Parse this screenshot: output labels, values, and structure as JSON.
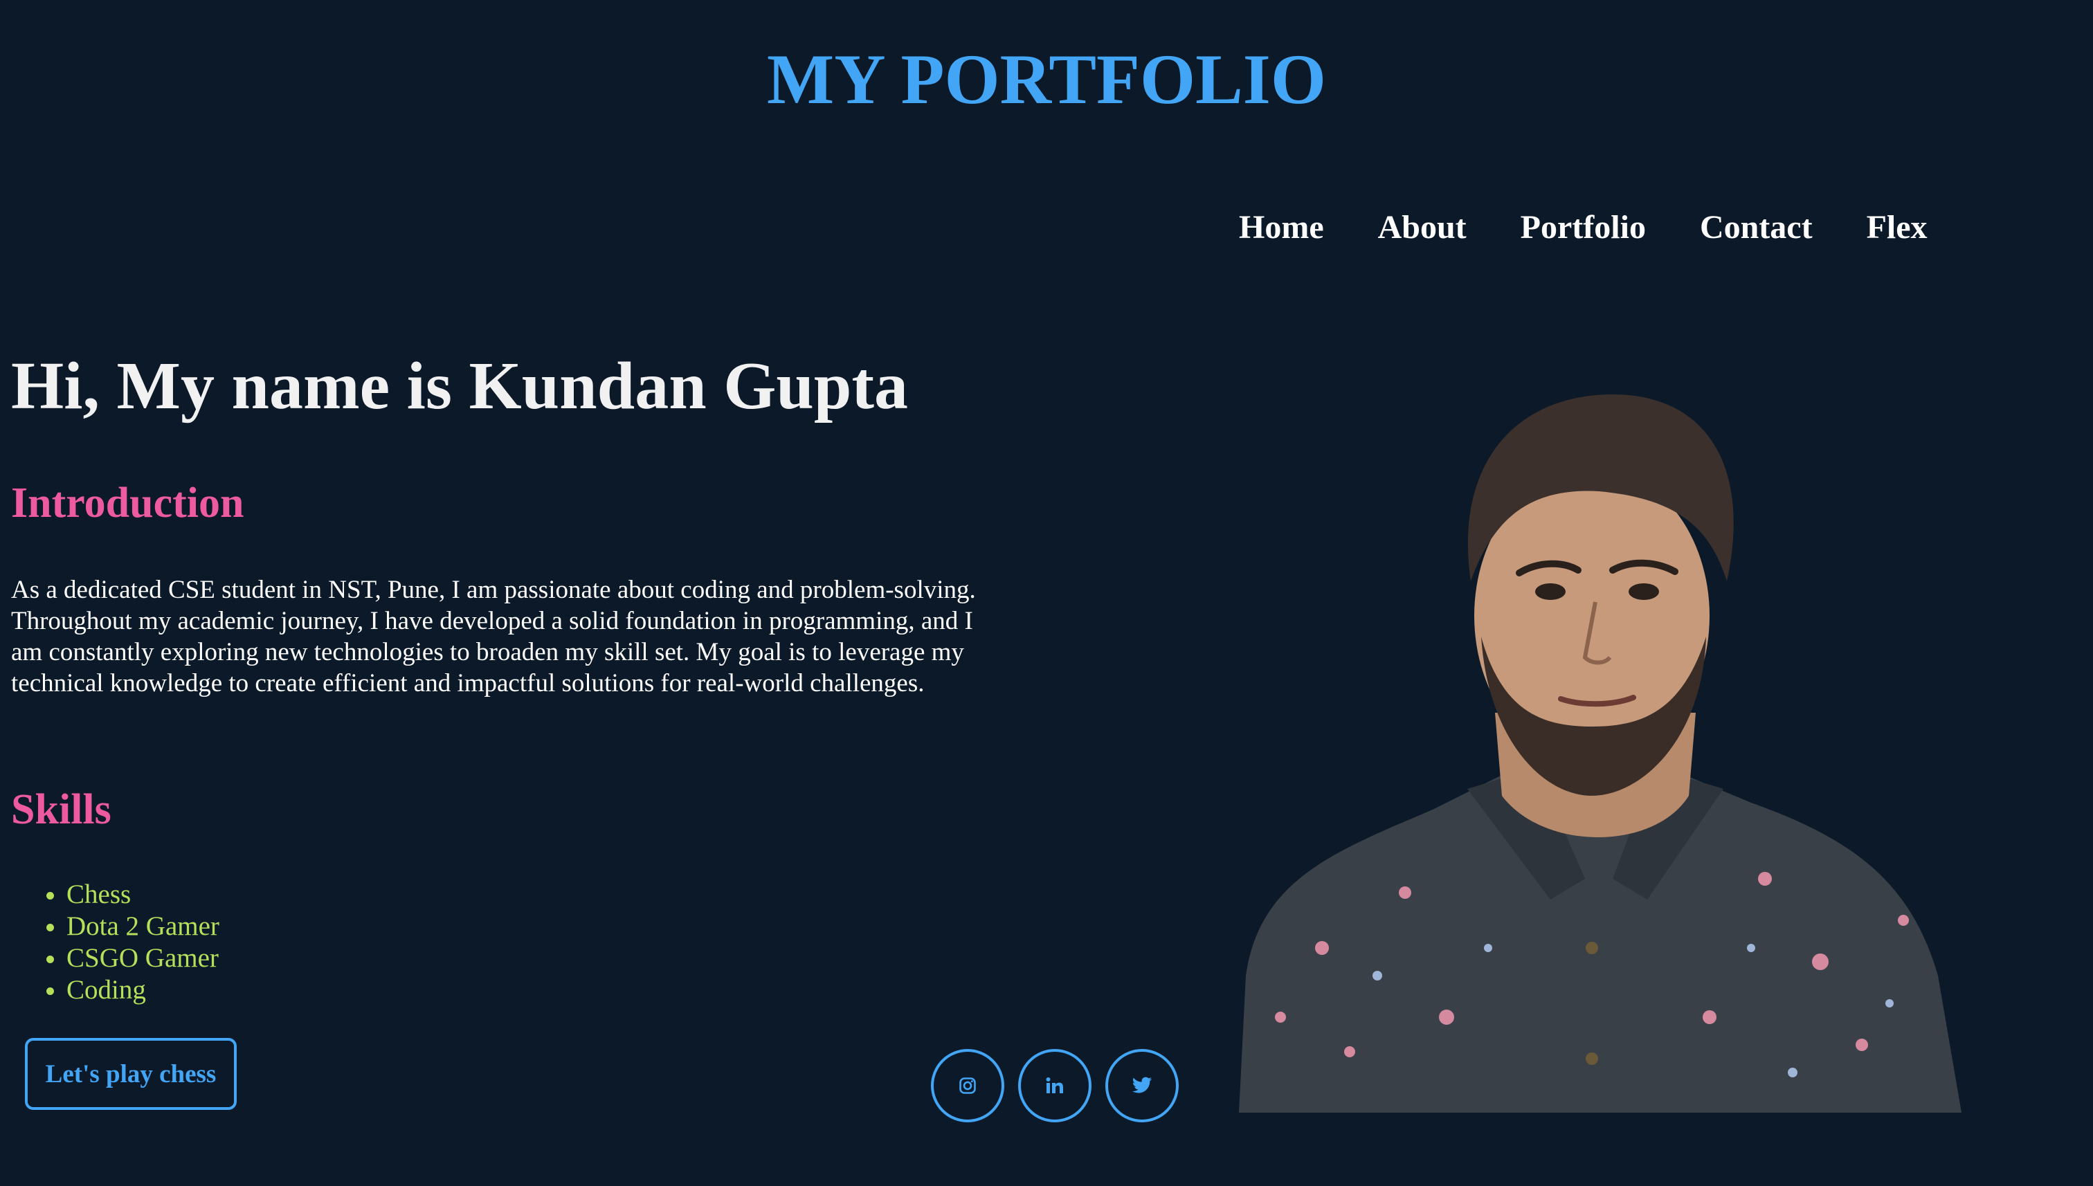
{
  "header": {
    "title": "MY PORTFOLIO"
  },
  "nav": {
    "items": [
      {
        "label": "Home"
      },
      {
        "label": "About"
      },
      {
        "label": "Portfolio"
      },
      {
        "label": "Contact"
      },
      {
        "label": "Flex"
      }
    ]
  },
  "hero": {
    "heading": "Hi, My name is Kundan Gupta"
  },
  "introduction": {
    "heading": "Introduction",
    "text": "As a dedicated CSE student in NST, Pune, I am passionate about coding and problem-solving. Throughout my academic journey, I have developed a solid foundation in programming, and I am constantly exploring new technologies to broaden my skill set. My goal is to leverage my technical knowledge to create efficient and impactful solutions for real-world challenges."
  },
  "skills": {
    "heading": "Skills",
    "items": [
      "Chess",
      "Dota 2 Gamer",
      "CSGO Gamer",
      "Coding"
    ]
  },
  "cta": {
    "label": "Let's play chess"
  },
  "social": {
    "icons": [
      "instagram-icon",
      "linkedin-icon",
      "twitter-icon"
    ]
  },
  "colors": {
    "background": "#0b1929",
    "accent": "#42a5f5",
    "heading_pink": "#ee5aa0",
    "skills_green": "#b6e05a",
    "text": "#ffffff"
  }
}
